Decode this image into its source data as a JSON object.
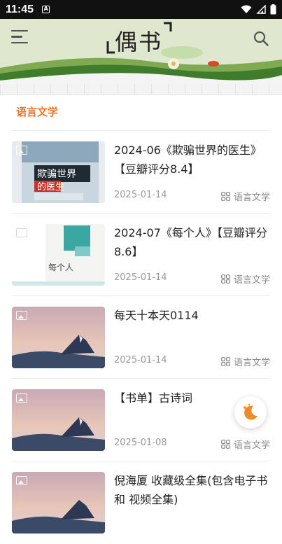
{
  "status_bar": {
    "time": "11:45",
    "notification_icon": "a-icon"
  },
  "header": {
    "logo_text": "偶书",
    "menu_icon": "menu-icon",
    "search_icon": "search-icon"
  },
  "section": {
    "title": "语言文学"
  },
  "items": [
    {
      "title": "2024-06《欺骗世界的医生》【豆瓣评分8.4】",
      "date": "2025-01-14",
      "category": "语言文学",
      "thumb": "book-cover-doctor"
    },
    {
      "title": "2024-07《每个人》【豆瓣评分8.6】",
      "date": "2025-01-14",
      "category": "语言文学",
      "thumb": "book-cover-everyman"
    },
    {
      "title": "每天十本天0114",
      "date": "2025-01-14",
      "category": "语言文学",
      "thumb": "mountain-landscape"
    },
    {
      "title": "【书单】古诗词",
      "date": "2025-01-08",
      "category": "语言文学",
      "thumb": "mountain-landscape"
    },
    {
      "title": "倪海厦 收藏级全集(包含电子书 和 视频全集)",
      "date": "",
      "category": "",
      "thumb": "mountain-landscape"
    }
  ],
  "fab": {
    "icon": "moon-night-mode-icon"
  },
  "colors": {
    "accent": "#e8762c",
    "header_bg": "#dfe8cf"
  }
}
